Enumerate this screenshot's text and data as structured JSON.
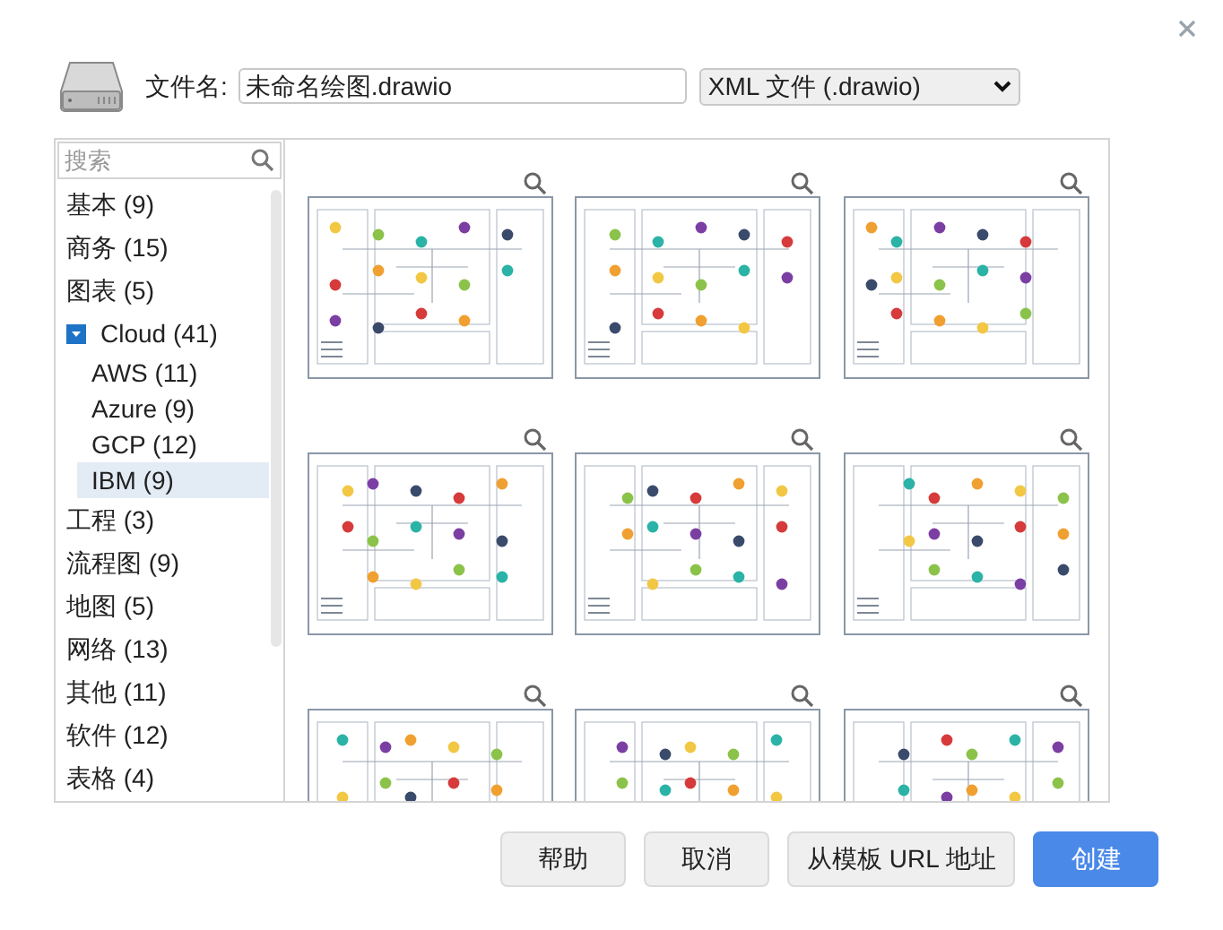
{
  "file_name": {
    "label": "文件名:",
    "value": "未命名绘图.drawio"
  },
  "format_select": {
    "value": "XML 文件 (.drawio)"
  },
  "search": {
    "placeholder": "搜索"
  },
  "categories": [
    {
      "label": "基本 (9)",
      "selected": false
    },
    {
      "label": "商务 (15)",
      "selected": false
    },
    {
      "label": "图表 (5)",
      "selected": false
    },
    {
      "label": "Cloud (41)",
      "selected": false,
      "expanded": true,
      "children": [
        {
          "label": "AWS (11)",
          "selected": false
        },
        {
          "label": "Azure (9)",
          "selected": false
        },
        {
          "label": "GCP (12)",
          "selected": false
        },
        {
          "label": "IBM (9)",
          "selected": true
        }
      ]
    },
    {
      "label": "工程 (3)",
      "selected": false
    },
    {
      "label": "流程图 (9)",
      "selected": false
    },
    {
      "label": "地图 (5)",
      "selected": false
    },
    {
      "label": "网络 (13)",
      "selected": false
    },
    {
      "label": "其他 (11)",
      "selected": false
    },
    {
      "label": "软件 (12)",
      "selected": false
    },
    {
      "label": "表格 (4)",
      "selected": false
    }
  ],
  "buttons": [
    {
      "label": "帮助",
      "kind": "plain"
    },
    {
      "label": "取消",
      "kind": "plain"
    },
    {
      "label": "从模板 URL 地址",
      "kind": "plain"
    },
    {
      "label": "创建",
      "kind": "primary"
    }
  ]
}
